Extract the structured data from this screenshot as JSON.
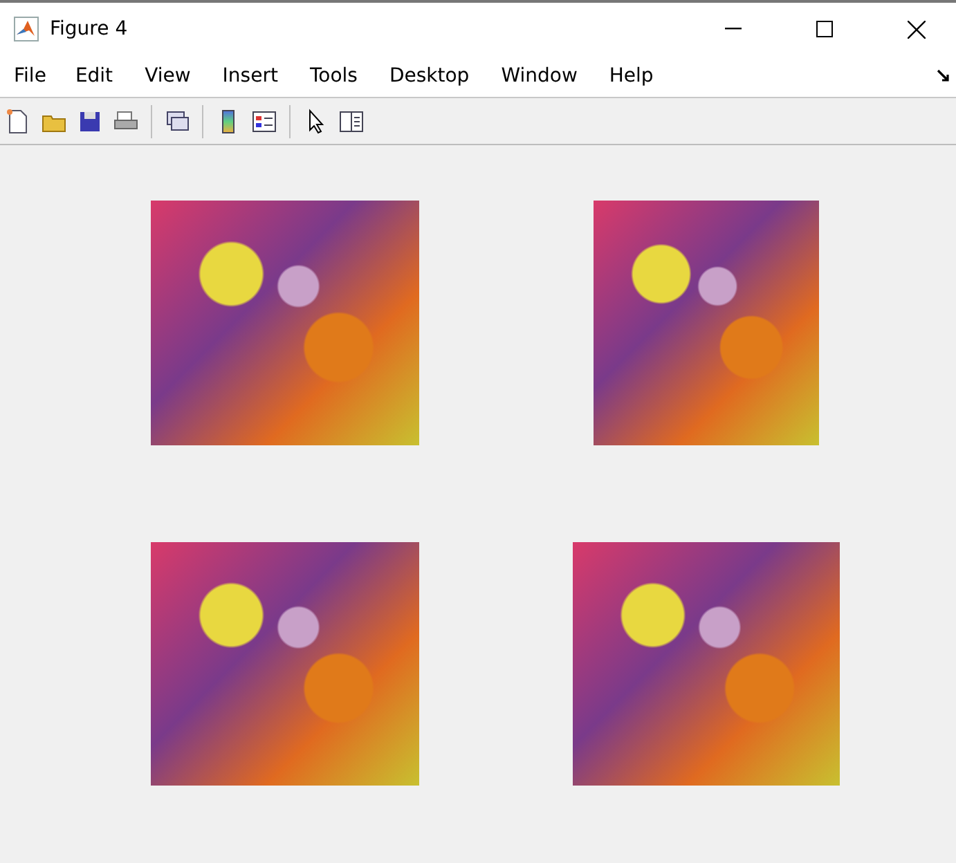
{
  "window": {
    "title": "Figure 4"
  },
  "menu": [
    "File",
    "Edit",
    "View",
    "Insert",
    "Tools",
    "Desktop",
    "Window",
    "Help"
  ],
  "axes": [
    {
      "kind": "image"
    },
    {
      "kind": "image"
    },
    {
      "kind": "image"
    },
    {
      "kind": "image"
    }
  ]
}
